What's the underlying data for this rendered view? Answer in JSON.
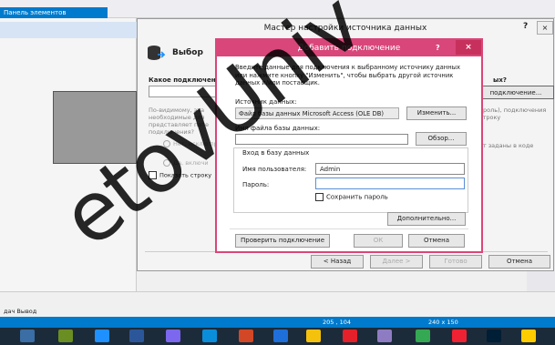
{
  "ide": {
    "tool_tab_label": "Панель элементов",
    "bottom_tabs": "дач  Вывод",
    "status_position": "205 , 104",
    "status_size": "240 x 150"
  },
  "wizard": {
    "title": "Мастер настройки источника данных",
    "help": "?",
    "close": "×",
    "header": "Выбор",
    "question_left": "Какое подключен",
    "note_left": "По-видимому, эта необходимые для представляет поте подключения?",
    "radio1": "Нет, исклю приложен",
    "radio2": "Да, включи",
    "show_string": "Показать строку",
    "question_right": "ых?",
    "new_connection": "подключение...",
    "right_note": "ароль), подключения строку",
    "right_note2": "ут заданы в коде",
    "back": "< Назад",
    "next": "Далее >",
    "finish": "Готово",
    "cancel": "Отмена"
  },
  "add_connection": {
    "title": "Добавить подключение",
    "help": "?",
    "close": "×",
    "description": "Введите данные для подключения к выбранному источнику данных или нажмите кнопку \"Изменить\", чтобы выбрать другой источник данных и/или поставщик.",
    "source_label": "Источник данных:",
    "source_value": "Файл базы данных Microsoft Access (OLE DB)",
    "change_button": "Изменить...",
    "file_label": "Имя файла базы данных:",
    "browse_button": "Обзор...",
    "login_group": "Вход в базу данных",
    "user_label": "Имя пользователя:",
    "user_value": "Admin",
    "password_label": "Пароль:",
    "save_password": "Сохранить пароль",
    "advanced_button": "Дополнительно...",
    "test_button": "Проверить подключение",
    "ok_button": "ОК",
    "cancel_button": "Отмена"
  },
  "watermark": "etovUniv",
  "colors": {
    "accent": "#007acc",
    "dialog": "#d9467a"
  }
}
